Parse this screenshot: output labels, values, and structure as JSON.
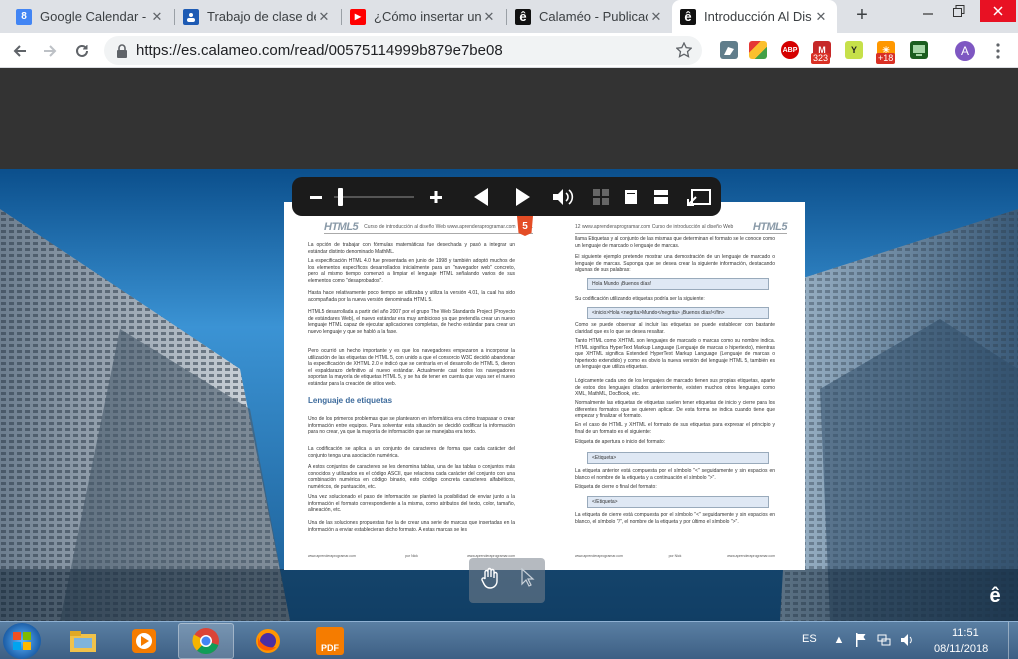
{
  "browser": {
    "tabs": [
      {
        "title": "Google Calendar -",
        "icon": "calendar-icon",
        "icon_text": "8",
        "color": "#4285f4",
        "active": false
      },
      {
        "title": "Trabajo de clase de",
        "icon": "classroom-icon",
        "icon_text": "",
        "color": "#1e5bb4",
        "active": false
      },
      {
        "title": "¿Cómo insertar un",
        "icon": "youtube-icon",
        "icon_text": "▶",
        "color": "#ff0000",
        "active": false
      },
      {
        "title": "Calaméo - Publicac",
        "icon": "calameo-icon",
        "icon_text": "ê",
        "color": "#111111",
        "active": false
      },
      {
        "title": "Introducción Al Dis",
        "icon": "calameo-icon",
        "icon_text": "ê",
        "color": "#111111",
        "active": true
      }
    ],
    "new_tab": "+",
    "url": "https://es.calameo.com/read/00575114999b879e7be08",
    "extensions": [
      {
        "name": "ink-icon",
        "label": "",
        "color": "#607d8b"
      },
      {
        "name": "stack-icon",
        "label": "",
        "color": "#43a047"
      },
      {
        "name": "adblock-icon",
        "label": "ABP",
        "color": "#d50000"
      },
      {
        "name": "gmail-checker-icon",
        "label": "M",
        "color": "#c62828",
        "badge": "323"
      },
      {
        "name": "yle-icon",
        "label": "Y",
        "color": "#c6e04a"
      },
      {
        "name": "weather-icon",
        "label": "☀",
        "color": "#ff9800",
        "badge": "+18"
      },
      {
        "name": "screen-icon",
        "label": "",
        "color": "#1b5e20"
      }
    ],
    "profile_initial": "A"
  },
  "document": {
    "left_page": {
      "header_text": "Curso de introducción al diseño Web  www.aprenderaprogramar.com",
      "page_number": "11",
      "logo": "HTML5",
      "paragraphs": [
        "La opción de trabajar con fórmulas matemáticas fue desechada y pasó a integrar un estándar distinto denominado MathML.",
        "La especificación HTML 4.0 fue presentada en junio de 1998 y también adoptó muchos de los elementos específicos desarrollados inicialmente para un \"navegador web\" concreto, pero al mismo tiempo comenzó a limpiar el lenguaje HTML señalando varios de sus elementos como \"desaprobados\".",
        "Hasta hace relativamente poco tiempo se utilizaba y utiliza la versión 4.01, la cual ha sido acompañada por la nueva versión denominada HTML 5.",
        "HTML5 desarrollada a partir del año 2007 por el grupo The Web Standards Project (Proyecto de estándares Web), el nuevo estándar era muy ambicioso ya que pretendía crear un nuevo lenguaje HTML capaz de ejecutar aplicaciones completas, de hecho estándar para crear un nuevo lenguaje y que se habló a la fase.",
        "Pero ocurrió un hecho importante y es que los navegadores empezaron a incorporar la utilización de las etiquetas de HTML 5, con unido a que el consorcio W3C decidió abandonar la especificación de XHTML 2.0 e indicó que se centraría en el desarrollo de HTML 5, dieron el espaldarazo definitivo al nuevo estándar. Actualmente casi todos los navegadores soportan la mayoría de etiquetas HTML 5, y se ha de tener en cuenta que vaya ser el nuevo estándar para la creación de sitios web."
      ],
      "section_title": "Lenguaje de etiquetas",
      "paragraphs2": [
        "Uno de los primeros problemas que se plantearon en informática era cómo traspasar o crear información entre equipos. Para solventar esta situación se decidió codificar la información para no crear, ya que la mayoría de información que se manejaba era texto.",
        "La codificación se aplica a un conjunto de caracteres de forma que cada carácter del conjunto tenga una asociación numérica.",
        "A estos conjuntos de caracteres se les denomina tablas, una de las tablas o conjuntos más conocidos y utilizados es el código ASCII, que relaciona cada carácter del conjunto con una combinación numérica en código binario, esto código concreta caracteres alfabéticos, numéricos, de puntuación, etc.",
        "Una vez solucionado el paso de información se planteó la posibilidad de enviar junto a la información el formato correspondiente a la misma, como atributos del texto, color, tamaño, alineación, etc.",
        "Una de las soluciones propuestas fue la de crear una serie de marcas que insertadas en la información a enviar establecieran dicho formato. A estas marcas se les"
      ],
      "footer_left": "www.aprenderaprogramar.com",
      "footer_mid": "por Nick",
      "footer_right": "www.aprenderaprogramar.com"
    },
    "right_page": {
      "header_text": "12  www.aprenderaprogramar.com   Curso de introducción al diseño Web",
      "logo": "HTML5",
      "paragraphs": [
        "llama Etiquetas y al conjunto de las mismas que determinan el formato se le conoce como un lenguaje de marcado o lenguaje de marcas.",
        "El siguiente ejemplo pretende mostrar una demostración de un lenguaje de marcado o lenguaje de marcas. Suponga que se desea crear la siguiente información, destacando algunas de sus palabras:"
      ],
      "box1": "Hola Mundo ¡Buenos días!",
      "para_b": "Su codificación utilizando etiquetas podría ser la siguiente:",
      "box2": "<inicio>Hola <negrita>Mundo</negrita> ¡Buenos días!</fin>",
      "paragraphs2": [
        "Como se puede observar al incluir las etiquetas se puede establecer con bastante claridad que es lo que se desea resaltar.",
        "Tanto HTML como XHTML son lenguajes de marcado o marcas como su nombre indica. HTML significa HyperText Markup Language (Lenguaje de marcas o hipertexto), mientras que XHTML significa Extended HyperText Markup Language (Lenguaje de marcas o hipertexto extendido) y como es obvio la nueva versión del lenguaje HTML 5, también es un lenguaje que utiliza etiquetas.",
        "Lógicamente cada uno de los lenguajes de marcado tienen sus propias etiquetas, aparte de estos dos lenguajes citados anteriormente, existen muchos otros lenguajes como XML, MathML, DocBook, etc.",
        "Normalmente las etiquetas de etiquetas suelen tener etiquetas de inicio y cierre para los diferentes formatos que se quieren aplicar. De esta forma se indica cuando tiene que empezar y finalizar el formato.",
        "En el caso de HTML y XHTML el formato de sus etiquetas para expresar el principio y final de un formato es el siguiente:",
        "Etiqueta de apertura o inicio del formato:"
      ],
      "box3": "<Etiqueta>",
      "para_c": "La etiqueta anterior está compuesta por el símbolo \"<\" seguidamente y sin espacios en blanco el nombre de la etiqueta y a continuación el símbolo \">\".",
      "para_d": "Etiqueta de cierre o final del formato:",
      "box4": "</Etiqueta>",
      "para_e": "La etiqueta de cierre está compuesta por el símbolo \"<\" seguidamente y sin espacios en blanco, el símbolo \"/\", el nombre de la etiqueta y por último el símbolo \">\".",
      "footer_left": "www.aprenderaprogramar.com",
      "footer_mid": "por Nick",
      "footer_right": "www.aprenderaprogramar.com"
    }
  },
  "viewer": {
    "zoom_level": 0.05,
    "watermark_logo": "ê"
  },
  "taskbar": {
    "apps": [
      {
        "name": "start-button"
      },
      {
        "name": "file-explorer-icon"
      },
      {
        "name": "media-player-icon"
      },
      {
        "name": "chrome-icon"
      },
      {
        "name": "firefox-icon"
      },
      {
        "name": "pdf-app-icon",
        "label": "PDF"
      }
    ],
    "language": "ES",
    "time": "11:51",
    "date": "08/11/2018"
  }
}
